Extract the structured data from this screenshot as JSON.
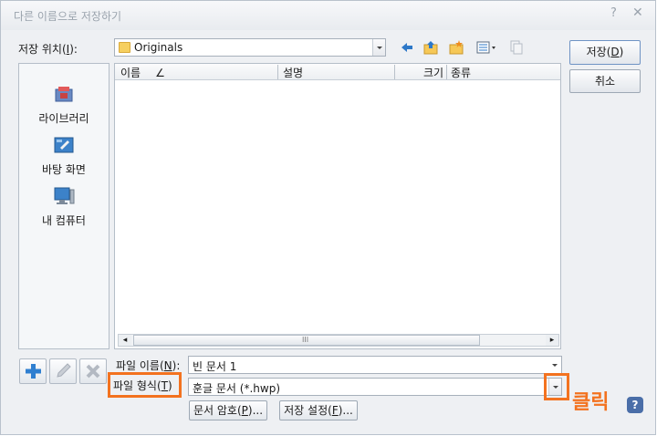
{
  "window": {
    "title": "다른 이름으로 저장하기",
    "help_glyph": "?",
    "close_glyph": "✕"
  },
  "location": {
    "label_pre": "저장 위치(",
    "label_key": "I",
    "label_post": "):",
    "folder": "Originals"
  },
  "buttons": {
    "save_pre": "저장(",
    "save_key": "D",
    "save_post": ")",
    "cancel": "취소",
    "doc_password_pre": "문서 암호(",
    "doc_password_key": "P",
    "doc_password_post": ")...",
    "save_settings_pre": "저장 설정(",
    "save_settings_key": "F",
    "save_settings_post": ")..."
  },
  "places": [
    {
      "label": "라이브러리",
      "icon": "library-icon"
    },
    {
      "label": "바탕 화면",
      "icon": "desktop-icon"
    },
    {
      "label": "내 컴퓨터",
      "icon": "computer-icon"
    }
  ],
  "columns": {
    "name": "이름",
    "sort_glyph": "∠",
    "description": "설명",
    "size": "크기",
    "type": "종류"
  },
  "scrollbar": {
    "left": "◂",
    "grip": "III",
    "right": "▸"
  },
  "filename": {
    "label_pre": "파일 이름(",
    "label_key": "N",
    "label_post": "):",
    "value": "빈 문서 1"
  },
  "filetype": {
    "label_pre": "파일 형식(",
    "label_key": "T",
    "label_post": ")",
    "value": "훈글 문서 (*.hwp)"
  },
  "annotation": {
    "text": "클릭"
  },
  "colors": {
    "accent_orange": "#f3721f",
    "dialog_bg": "#eef0f3",
    "border": "#a7b0bb"
  }
}
